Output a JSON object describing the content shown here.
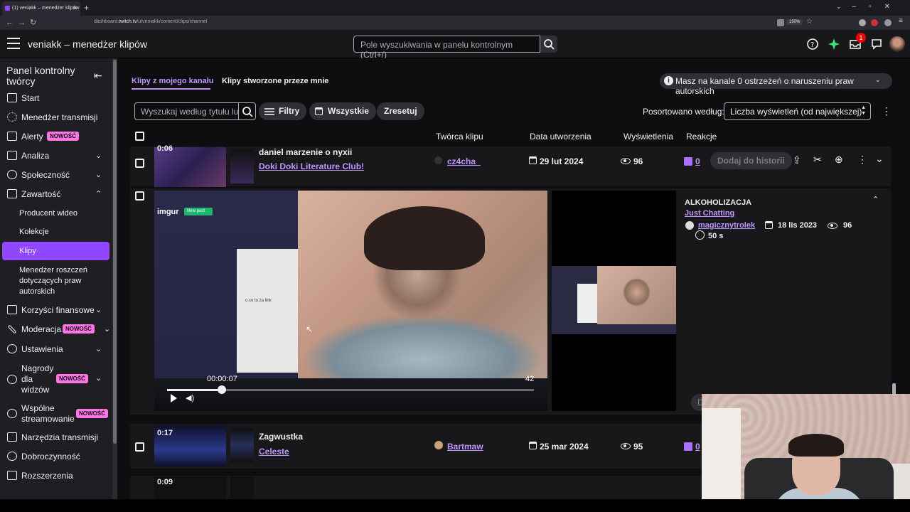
{
  "browser": {
    "tab_title": "(1) veniakk – menedżer klipów",
    "url_prefix": "dashboard.",
    "url_domain": "twitch.tv",
    "url_path": "/u/veniakk/content/clips/channel",
    "zoom": "150%"
  },
  "topbar": {
    "title": "veniakk – menedżer klipów",
    "search_placeholder": "Pole wyszukiwania w panelu kontrolnym (Ctrl+/)",
    "notification_count": "1"
  },
  "sidebar": {
    "title": "Panel kontrolny twórcy",
    "items": [
      {
        "label": "Start"
      },
      {
        "label": "Menedżer transmisji"
      },
      {
        "label": "Alerty",
        "badge": "NOWOŚĆ"
      },
      {
        "label": "Analiza"
      },
      {
        "label": "Społeczność"
      },
      {
        "label": "Zawartość"
      },
      {
        "label": "Korzyści finansowe"
      },
      {
        "label": "Moderacja",
        "badge": "NOWOŚĆ"
      },
      {
        "label": "Ustawienia"
      },
      {
        "label": "Nagrody dla widzów",
        "badge": "NOWOŚĆ"
      },
      {
        "label": "Wspólne streamowanie",
        "badge": "NOWOŚĆ"
      },
      {
        "label": "Narzędzia transmisji"
      },
      {
        "label": "Dobroczynność"
      },
      {
        "label": "Rozszerzenia"
      }
    ],
    "content_sub": [
      {
        "label": "Producent wideo"
      },
      {
        "label": "Kolekcje"
      },
      {
        "label": "Klipy"
      },
      {
        "label": "Menedżer roszczeń dotyczących praw autorskich"
      }
    ],
    "line_nagrody_1": "Nagrody",
    "line_nagrody_2": "dla",
    "line_nagrody_3": "widzów",
    "line_wspolne_1": "Wspólne",
    "line_wspolne_2": "streamowanie",
    "line_menedzer_1": "Menedżer roszczeń",
    "line_menedzer_2": "dotyczących praw",
    "line_menedzer_3": "autorskich",
    "active_item": "Klipy"
  },
  "main": {
    "tabs": [
      {
        "label": "Klipy z mojego kanału",
        "active": true
      },
      {
        "label": "Klipy stworzone przeze mnie",
        "active": false
      }
    ],
    "copyright_notice": "Masz na kanale 0 ostrzeżeń o naruszeniu praw autorskich",
    "search_placeholder": "Wyszukaj według tytułu lub",
    "filters_label": "Filtry",
    "all_label": "Wszystkie",
    "reset_label": "Zresetuj",
    "sort_label": "Posortowano według:",
    "sort_value": "Liczba wyświetleń (od największej)",
    "columns": [
      "Twórca klipu",
      "Data utworzenia",
      "Wyświetlenia",
      "Reakcje"
    ],
    "add_to_history": "Dodaj do historii"
  },
  "clips": [
    {
      "duration": "0:06",
      "title": "daniel marzenie o nyxii",
      "game": "Doki Doki Literature Club!",
      "author": "cz4cha_",
      "date": "29 lut 2024",
      "views": "96",
      "reactions": "0"
    },
    {
      "duration": "",
      "title": "ALKOHOLIZACJA",
      "game": "Just Chatting",
      "author": "magicznytrolek",
      "date": "18 lis 2023",
      "views": "96",
      "clip_length": "50 s",
      "expanded": true
    },
    {
      "duration": "0:17",
      "title": "Zagwustka",
      "game": "Celeste",
      "author": "Bartmaw",
      "date": "25 mar 2024",
      "views": "95",
      "reactions": "0"
    },
    {
      "duration": "0:09",
      "title": "",
      "game": "",
      "author": "",
      "date": "",
      "views": "",
      "reactions": ""
    }
  ],
  "player": {
    "current_time": "00:00:07",
    "total": "42",
    "progress": 0.15,
    "imgur_label": "imgur",
    "new_post_label": "New post",
    "doc_text": "o co to za link",
    "history_partial": "Do"
  },
  "colors": {
    "accent": "#9147ff",
    "link": "#bf94ff",
    "new_badge": "#ff75e6",
    "notification": "#eb0400"
  }
}
